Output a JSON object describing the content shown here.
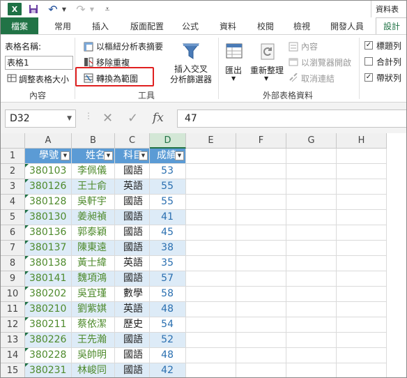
{
  "titlebar": {
    "logo": "X",
    "contextual_tab": "資料表"
  },
  "tabs": [
    "檔案",
    "常用",
    "插入",
    "版面配置",
    "公式",
    "資料",
    "校閱",
    "檢視",
    "開發人員",
    "設計"
  ],
  "ribbon": {
    "properties": {
      "name_label": "表格名稱:",
      "name_value": "表格1",
      "resize_label": "調整表格大小",
      "group_label": "內容"
    },
    "tools": {
      "summarize_label": "以樞紐分析表摘要",
      "remove_dup_label": "移除重複",
      "convert_label": "轉換為範圍",
      "slicer_label_1": "插入交叉",
      "slicer_label_2": "分析篩選器",
      "group_label": "工具"
    },
    "external": {
      "export_label": "匯出",
      "refresh_label": "重新整理",
      "properties_label": "內容",
      "open_browser_label": "以瀏覽器開啟",
      "unlink_label": "取消連結",
      "group_label": "外部表格資料"
    },
    "style_options": {
      "header_row": "標題列",
      "total_row": "合計列",
      "banded_rows": "帶狀列"
    }
  },
  "formula_bar": {
    "name_box": "D32",
    "value": "47",
    "fx": "fx"
  },
  "sheet": {
    "columns": [
      "A",
      "B",
      "C",
      "D",
      "E",
      "F",
      "G",
      "H"
    ],
    "row_numbers": [
      "1",
      "2",
      "3",
      "4",
      "5",
      "6",
      "7",
      "8",
      "9",
      "10",
      "11",
      "12",
      "13",
      "14",
      "15"
    ],
    "headers": [
      "學號",
      "姓名",
      "科目",
      "成績"
    ],
    "rows": [
      [
        "380103",
        "李佩儀",
        "國語",
        "53"
      ],
      [
        "380126",
        "王士俞",
        "英語",
        "55"
      ],
      [
        "380128",
        "吳軒宇",
        "國語",
        "55"
      ],
      [
        "380130",
        "姜昶禎",
        "國語",
        "41"
      ],
      [
        "380136",
        "郭泰穎",
        "國語",
        "45"
      ],
      [
        "380137",
        "陳東遠",
        "國語",
        "38"
      ],
      [
        "380138",
        "黃士緯",
        "英語",
        "35"
      ],
      [
        "380141",
        "魏項鴻",
        "國語",
        "57"
      ],
      [
        "380202",
        "吳宜瑾",
        "數學",
        "58"
      ],
      [
        "380210",
        "劉紫娸",
        "英語",
        "48"
      ],
      [
        "380211",
        "蔡依潔",
        "歷史",
        "54"
      ],
      [
        "380226",
        "王先瀚",
        "國語",
        "52"
      ],
      [
        "380228",
        "吳帥明",
        "國語",
        "48"
      ],
      [
        "380231",
        "林峻同",
        "國語",
        "42"
      ]
    ]
  }
}
